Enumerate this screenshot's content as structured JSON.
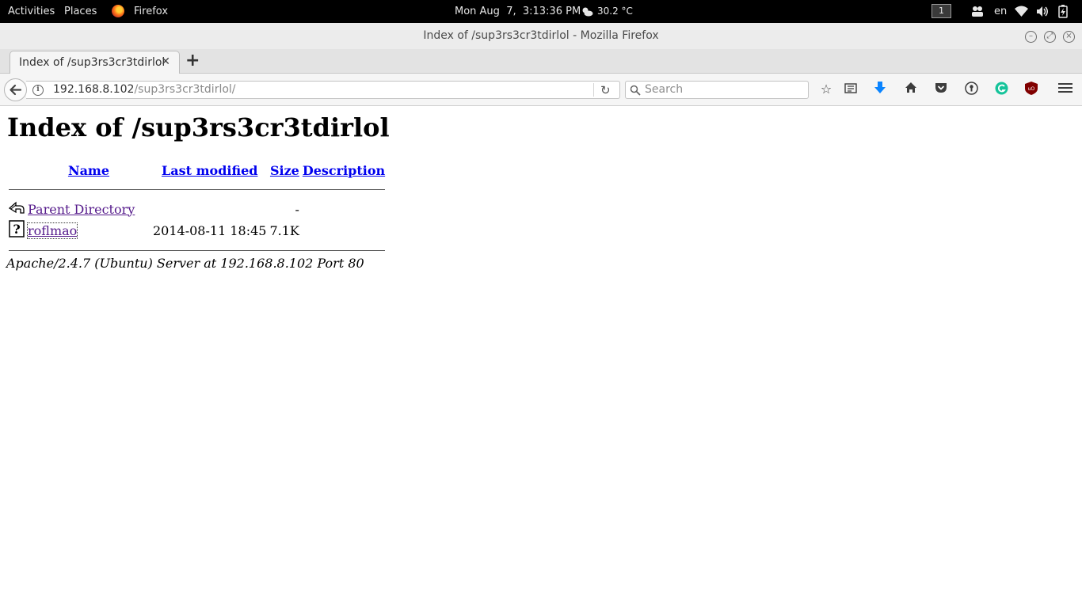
{
  "topbar": {
    "activities": "Activities",
    "places": "Places",
    "app_name": "Firefox",
    "clock": "Mon Aug  7,  3:13:36 PM",
    "weather": "30.2 °C",
    "workspace": "1",
    "keyboard_layout": "en"
  },
  "window": {
    "title": "Index of /sup3rs3cr3tdirlol - Mozilla Firefox"
  },
  "tabs": [
    {
      "label": "Index of /sup3rs3cr3tdirlol",
      "active": true
    }
  ],
  "navbar": {
    "url_host": "192.168.8.102",
    "url_path": "/sup3rs3cr3tdirlol/",
    "search_placeholder": "Search"
  },
  "page": {
    "heading": "Index of /sup3rs3cr3tdirlol",
    "columns": [
      "Name",
      "Last modified",
      "Size",
      "Description"
    ],
    "rows": [
      {
        "icon": "back-arrow-icon",
        "name": "Parent Directory",
        "modified": "",
        "size": "-",
        "description": ""
      },
      {
        "icon": "unknown-file-icon",
        "name": "roflmao",
        "modified": "2014-08-11 18:45",
        "size": "7.1K",
        "description": ""
      }
    ],
    "footer": "Apache/2.4.7 (Ubuntu) Server at 192.168.8.102 Port 80"
  },
  "colors": {
    "link": "#0000ee",
    "visited_link": "#551a8b",
    "topbar_bg": "#000000",
    "download_accent": "#0a84ff",
    "grammarly_green": "#15c39a",
    "ublock_red": "#800000"
  }
}
